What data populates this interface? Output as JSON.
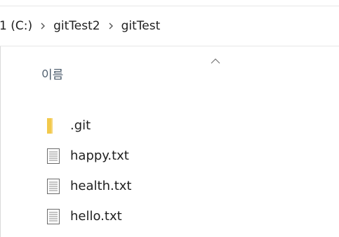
{
  "breadcrumb": {
    "items": [
      "1 (C:)",
      "gitTest2",
      "gitTest"
    ]
  },
  "list": {
    "column_name": "이름",
    "sort": "ascending",
    "files": [
      {
        "name": ".git",
        "icon": "folder-icon"
      },
      {
        "name": "happy.txt",
        "icon": "text-file-icon"
      },
      {
        "name": "health.txt",
        "icon": "text-file-icon"
      },
      {
        "name": "hello.txt",
        "icon": "text-file-icon"
      }
    ]
  },
  "colors": {
    "folder": "#f2c94c",
    "text": "#1f1f1f",
    "header_text": "#4a5a6a",
    "border": "#e6e6e6"
  }
}
